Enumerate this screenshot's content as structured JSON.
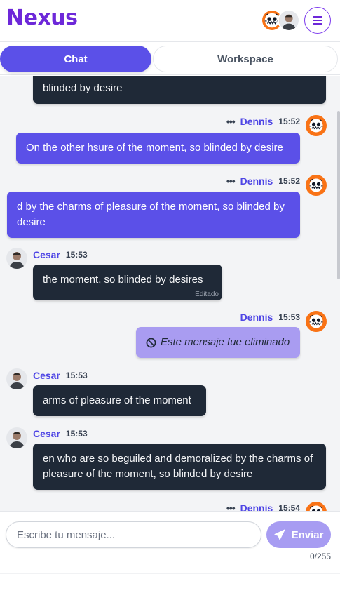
{
  "app": {
    "logo": "Nexus"
  },
  "header": {
    "menu_icon": "hamburger-menu-icon"
  },
  "tabs": [
    {
      "label": "Chat",
      "active": true
    },
    {
      "label": "Workspace",
      "active": false
    }
  ],
  "messages": [
    {
      "text": "blinded by desire"
    },
    {
      "author": "Dennis",
      "time": "15:52",
      "text": "On the other hsure of the moment, so blinded by desire"
    },
    {
      "author": "Dennis",
      "time": "15:52",
      "text": "d by the charms of pleasure of the moment, so blinded by desire"
    },
    {
      "author": "Cesar",
      "time": "15:53",
      "text": "the moment, so blinded by desires",
      "edited_label": "Editado"
    },
    {
      "author": "Dennis",
      "time": "15:53",
      "text": "Este mensaje fue eliminado"
    },
    {
      "author": "Cesar",
      "time": "15:53",
      "text": "arms of pleasure of the moment"
    },
    {
      "author": "Cesar",
      "time": "15:53",
      "text": "en who are so beguiled and demoralized by the charms of pleasure of the moment, so blinded by desire"
    },
    {
      "author": "Dennis",
      "time": "15:54"
    }
  ],
  "options_glyph": "•••",
  "composer": {
    "placeholder": "Escribe tu mensaje...",
    "send_label": "Enviar",
    "counter": "0/255"
  },
  "colors": {
    "brand": "#6d28d9",
    "accent": "#5b50e8",
    "dark_bubble": "#1f2937",
    "deleted_bubble": "#a99cf1",
    "send_button": "#a79cf2"
  }
}
